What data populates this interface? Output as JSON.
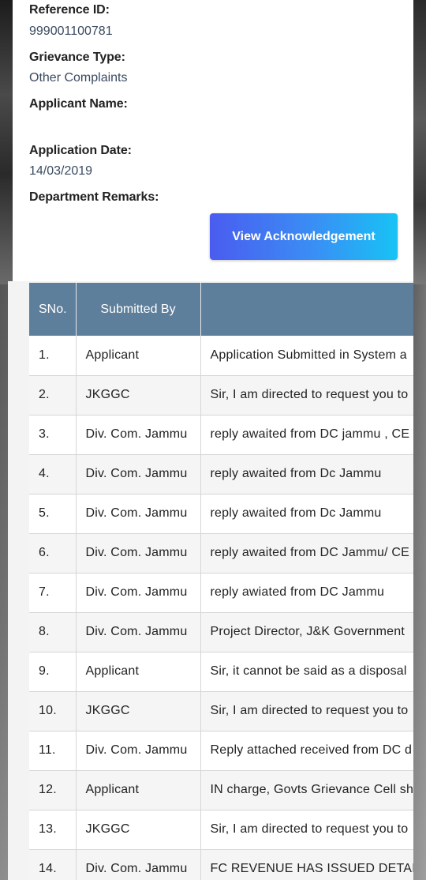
{
  "details": {
    "reference_id_label": "Reference ID:",
    "reference_id_value": "999001100781",
    "grievance_type_label": "Grievance Type:",
    "grievance_type_value": "Other Complaints",
    "applicant_name_label": "Applicant Name:",
    "applicant_name_value": "",
    "application_date_label": "Application Date:",
    "application_date_value": "14/03/2019",
    "department_remarks_label": "Department Remarks:"
  },
  "buttons": {
    "view_acknowledgement": "View Acknowledgement"
  },
  "table": {
    "headers": [
      "SNo.",
      "Submitted By",
      ""
    ],
    "rows": [
      {
        "sno": "1.",
        "by": "Applicant",
        "remark": "Application Submitted in System a"
      },
      {
        "sno": "2.",
        "by": "JKGGC",
        "remark": "Sir, I am directed to request you to"
      },
      {
        "sno": "3.",
        "by": "Div. Com. Jammu",
        "remark": "reply awaited from DC jammu , CE"
      },
      {
        "sno": "4.",
        "by": "Div. Com. Jammu",
        "remark": "reply awaited from Dc Jammu"
      },
      {
        "sno": "5.",
        "by": "Div. Com. Jammu",
        "remark": "reply awaited from Dc Jammu"
      },
      {
        "sno": "6.",
        "by": "Div. Com. Jammu",
        "remark": "reply awaited from DC Jammu/ CE"
      },
      {
        "sno": "7.",
        "by": "Div. Com. Jammu",
        "remark": "reply awiated from DC Jammu"
      },
      {
        "sno": "8.",
        "by": "Div. Com. Jammu",
        "remark": "Project Director, J&K Government"
      },
      {
        "sno": "9.",
        "by": "Applicant",
        "remark": "Sir, it cannot be said as a disposal"
      },
      {
        "sno": "10.",
        "by": "JKGGC",
        "remark": "Sir, I am directed to request you to"
      },
      {
        "sno": "11.",
        "by": "Div. Com. Jammu",
        "remark": "Reply attached received from DC d"
      },
      {
        "sno": "12.",
        "by": "Applicant",
        "remark": "IN charge, Govts Grievance Cell sh"
      },
      {
        "sno": "13.",
        "by": "JKGGC",
        "remark": "Sir, I am directed to request you to"
      },
      {
        "sno": "14.",
        "by": "Div. Com. Jammu",
        "remark": "FC REVENUE HAS ISSUED DETAILE"
      }
    ]
  }
}
